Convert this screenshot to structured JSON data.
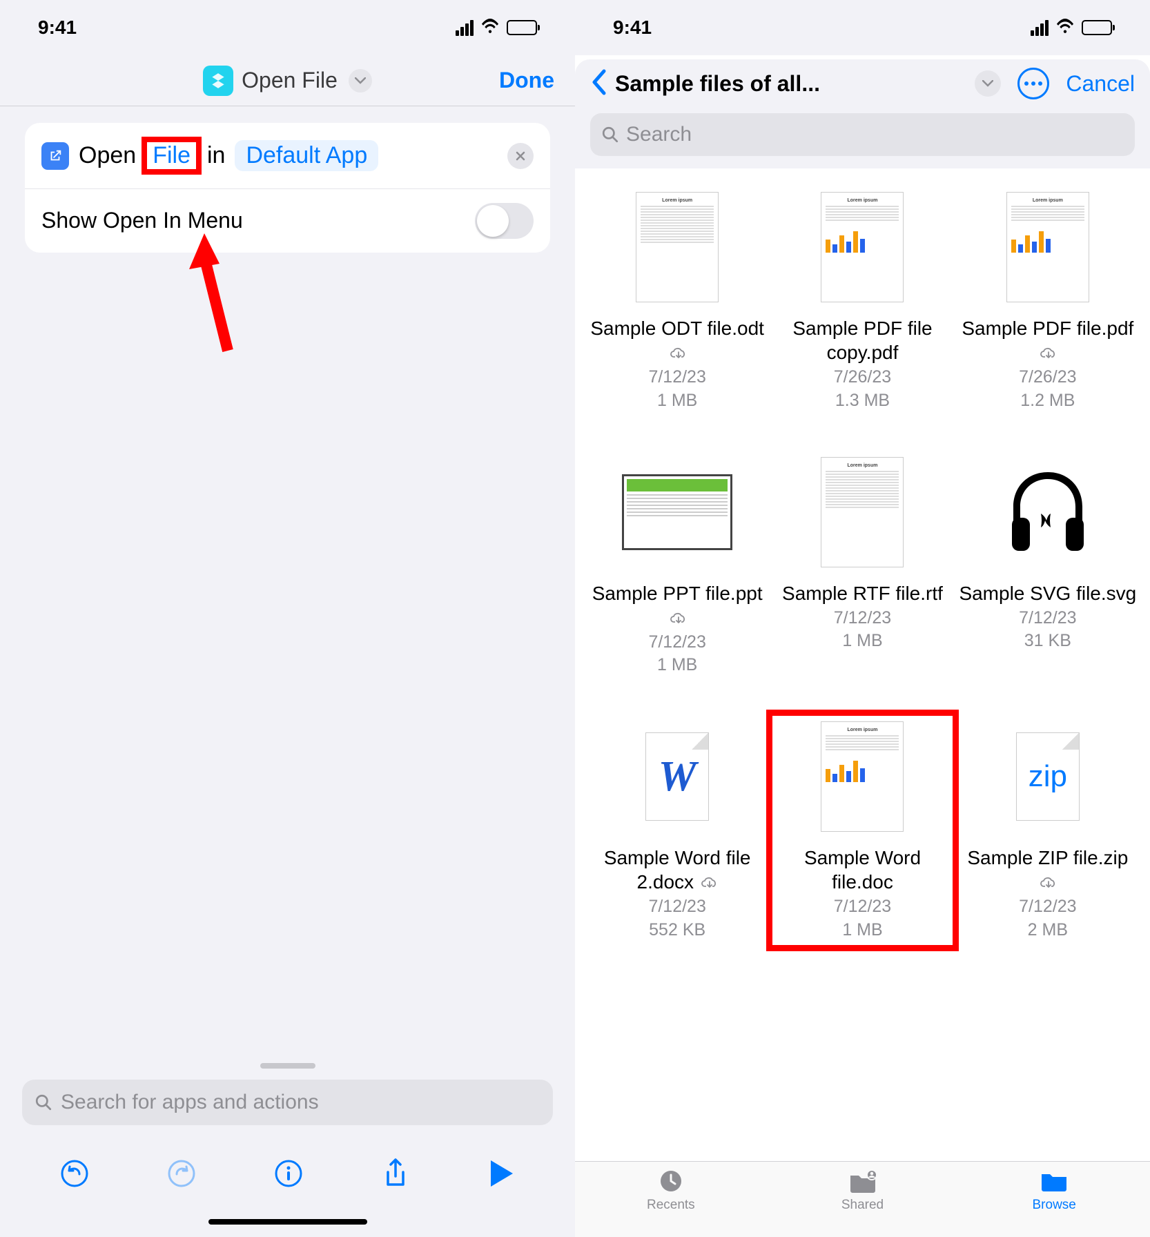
{
  "status": {
    "time": "9:41"
  },
  "left": {
    "header": {
      "title": "Open File",
      "done": "Done"
    },
    "action": {
      "open": "Open",
      "file_token": "File",
      "in": "in",
      "app_token": "Default App"
    },
    "toggle": {
      "label": "Show Open In Menu"
    },
    "search": {
      "placeholder": "Search for apps and actions"
    }
  },
  "right": {
    "header": {
      "title": "Sample files of all...",
      "cancel": "Cancel"
    },
    "search": {
      "placeholder": "Search"
    },
    "files": [
      {
        "name": "Sample ODT file.odt",
        "cloud": true,
        "date": "7/12/23",
        "size": "1 MB",
        "thumb": "doc-text"
      },
      {
        "name": "Sample PDF file copy.pdf",
        "cloud": false,
        "date": "7/26/23",
        "size": "1.3 MB",
        "thumb": "doc-chart"
      },
      {
        "name": "Sample PDF file.pdf",
        "cloud": true,
        "date": "7/26/23",
        "size": "1.2 MB",
        "thumb": "doc-chart"
      },
      {
        "name": "Sample PPT file.ppt",
        "cloud": true,
        "date": "7/12/23",
        "size": "1 MB",
        "thumb": "ppt"
      },
      {
        "name": "Sample RTF file.rtf",
        "cloud": false,
        "date": "7/12/23",
        "size": "1 MB",
        "thumb": "doc-text"
      },
      {
        "name": "Sample SVG file.svg",
        "cloud": false,
        "date": "7/12/23",
        "size": "31 KB",
        "thumb": "svg"
      },
      {
        "name": "Sample Word file 2.docx",
        "cloud": true,
        "date": "7/12/23",
        "size": "552 KB",
        "thumb": "w"
      },
      {
        "name": "Sample Word file.doc",
        "cloud": false,
        "date": "7/12/23",
        "size": "1 MB",
        "thumb": "doc-chart",
        "highlight": true
      },
      {
        "name": "Sample ZIP file.zip",
        "cloud": true,
        "date": "7/12/23",
        "size": "2 MB",
        "thumb": "zip"
      }
    ],
    "tabs": {
      "recents": "Recents",
      "shared": "Shared",
      "browse": "Browse"
    }
  }
}
